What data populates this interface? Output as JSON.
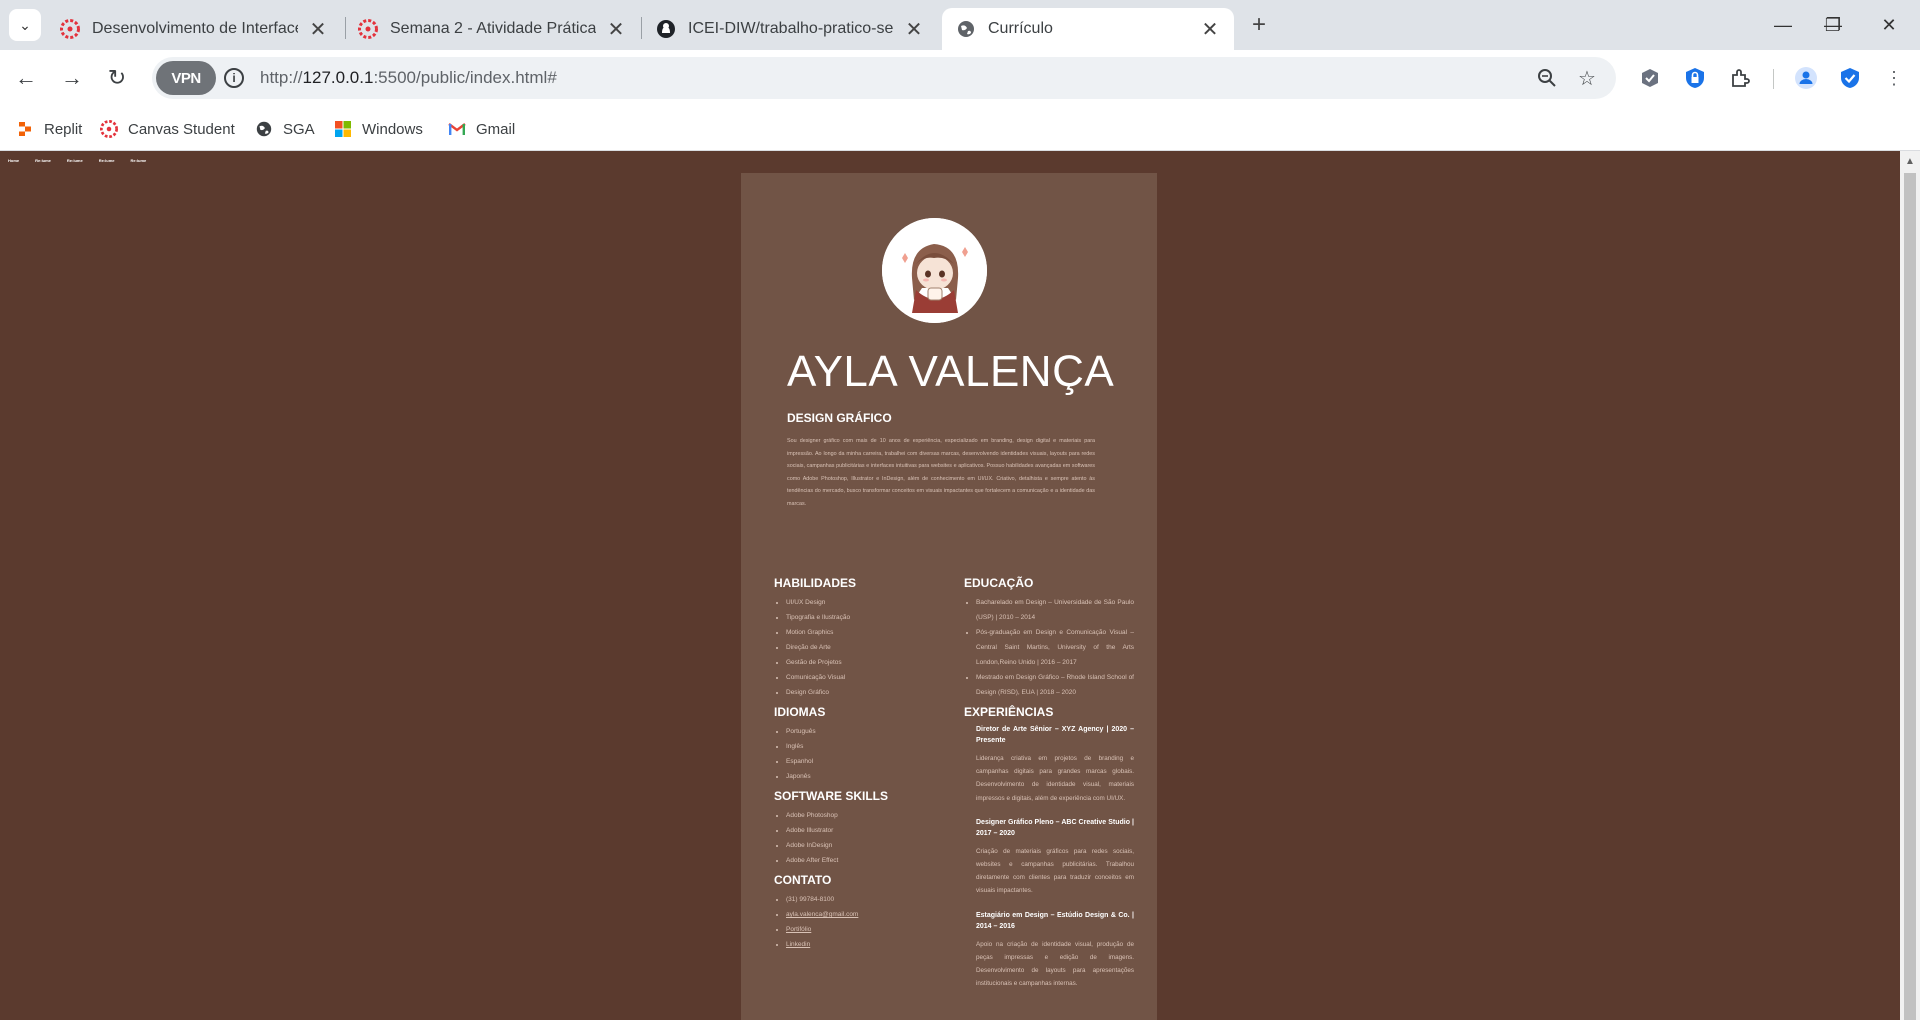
{
  "browser": {
    "tabs": [
      {
        "title": "Desenvolvimento de Interfaces",
        "icon": "canvas-icon"
      },
      {
        "title": "Semana 2 - Atividade Prática",
        "icon": "canvas-icon"
      },
      {
        "title": "ICEI-DIW/trabalho-pratico-sem",
        "icon": "github-icon"
      },
      {
        "title": "Currículo",
        "icon": "globe-icon",
        "active": true
      }
    ],
    "vpn_label": "VPN",
    "url_prefix": "http://",
    "url_host": "127.0.0.1",
    "url_rest": ":5500/public/index.html#",
    "bookmarks": [
      {
        "label": "Replit",
        "icon": "replit-icon"
      },
      {
        "label": "Canvas Student",
        "icon": "canvas-icon"
      },
      {
        "label": "SGA",
        "icon": "globe-icon"
      },
      {
        "label": "Windows",
        "icon": "windows-icon"
      },
      {
        "label": "Gmail",
        "icon": "gmail-icon"
      }
    ]
  },
  "page": {
    "nav": [
      "Home",
      "Re:lume",
      "Re:lume",
      "Re:lume",
      "Re:lume"
    ],
    "name": "AYLA VALENÇA",
    "role": "DESIGN GRÁFICO",
    "summary": "Sou designer gráfico com mais de 10 anos de experiência, especializado em branding, design digital e materiais para impressão. Ao longo da minha carreira, trabalhei com diversas marcas, desenvolvendo identidades visuais, layouts para redes sociais, campanhas publicitárias e interfaces intuitivas para websites e aplicativos. Possuo habilidades avançadas em softwares como Adobe Photoshop, Illustrator e InDesign, além de conhecimento em UI/UX. Criativo, detalhista e sempre atento às tendências do mercado, busco transformar conceitos em visuais impactantes que fortalecem a comunicação e a identidade das marcas.",
    "skills_title": "HABILIDADES",
    "skills": [
      "UI/UX Design",
      "Tipografia e Ilustração",
      "Motion Graphics",
      "Direção de Arte",
      "Gestão de Projetos",
      "Comunicação Visual",
      "Design Gráfico"
    ],
    "languages_title": "IDIOMAS",
    "languages": [
      "Português",
      "Inglês",
      "Espanhol",
      "Japonês"
    ],
    "software_title": "SOFTWARE SKILLS",
    "software": [
      "Adobe Photoshop",
      "Adobe Illustrator",
      "Adobe InDesign",
      "Adobe After Effect"
    ],
    "contact_title": "CONTATO",
    "contact_phone": "(31) 99784-8100",
    "contact_links": [
      "ayla.valenca@gmail.com",
      "Portifólio",
      "Linkedin"
    ],
    "education_title": "EDUCAÇÃO",
    "education": [
      "Bacharelado em Design – Universidade de São Paulo (USP) | 2010 – 2014",
      "Pós-graduação em Design e Comunicação Visual – Central Saint Martins, University of the Arts London,Reino Unido | 2016 – 2017",
      "Mestrado em Design Gráfico – Rhode Island School of Design (RISD), EUA | 2018 – 2020"
    ],
    "experience_title": "EXPERIÊNCIAS",
    "experience": [
      {
        "title": "Diretor de Arte Sênior – XYZ Agency | 2020 – Presente",
        "text": "Liderança criativa em projetos de branding e campanhas digitais para grandes marcas globais. Desenvolvimento de identidade visual, materiais impressos e digitais, além de experiência com UI/UX."
      },
      {
        "title": "Designer Gráfico Pleno – ABC Creative Studio | 2017 – 2020",
        "text": "Criação de materiais gráficos para redes sociais, websites e campanhas publicitárias. Trabalhou diretamente com clientes para traduzir conceitos em visuais impactantes."
      },
      {
        "title": "Estagiário em Design – Estúdio Design & Co. | 2014 – 2016",
        "text": "Apoio na criação de identidade visual, produção de peças impressas e edição de imagens. Desenvolvimento de layouts para apresentações institucionais e campanhas internas."
      }
    ]
  }
}
